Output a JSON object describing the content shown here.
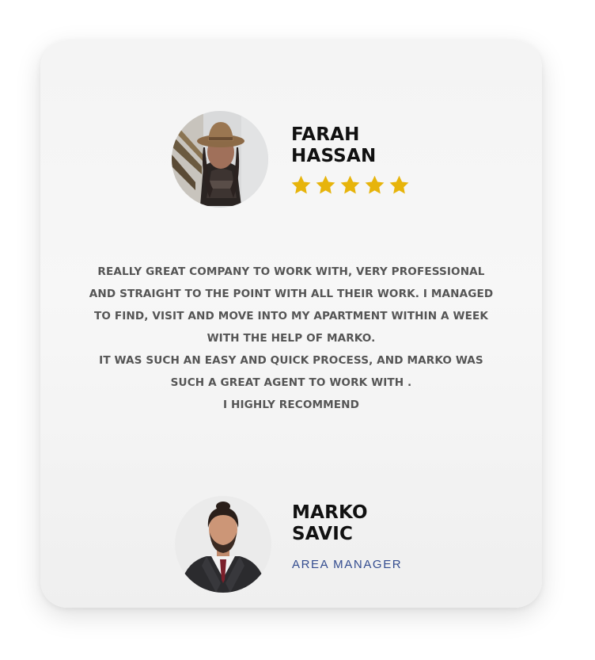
{
  "reviewer": {
    "name": "FARAH\nHASSAN",
    "rating": 5,
    "star_color": "#e7b40b"
  },
  "testimonial": {
    "text": "REALLY GREAT COMPANY TO WORK WITH, VERY PROFESSIONAL\nAND STRAIGHT TO THE POINT WITH ALL THEIR WORK. I MANAGED\nTO FIND, VISIT AND MOVE INTO MY APARTMENT WITHIN A WEEK\nWITH THE HELP OF MARKO.\nIT WAS SUCH AN EASY AND QUICK PROCESS, AND MARKO WAS\nSUCH A GREAT AGENT TO WORK WITH .\nI HIGHLY RECOMMEND"
  },
  "agent": {
    "name": "MARKO\nSAVIC",
    "role": "AREA MANAGER",
    "role_color": "#334c8f"
  }
}
